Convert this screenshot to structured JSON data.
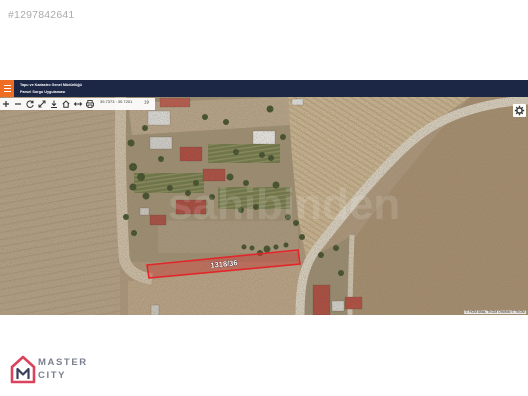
{
  "listing": {
    "id": "#1297842641"
  },
  "watermark": "sahibinden",
  "app": {
    "org_name": "Tapu ve Kadastro Genel Müdürlüğü",
    "app_name": "Parsel Sorgu Uygulaması",
    "menu_icon": "hamburger-menu-icon",
    "colors": {
      "header": "#1b2745",
      "menu_button": "#ef6c23",
      "parcel": "#e3262a"
    }
  },
  "toolbar": {
    "tools": [
      "zoom-in-icon",
      "zoom-out-icon",
      "rotate-icon",
      "fullscreen-icon",
      "download-icon",
      "home-icon",
      "measure-icon",
      "print-icon"
    ],
    "coordinates": "39.7373 : 30.7201",
    "zoom_level": "19"
  },
  "map": {
    "settings_icon": "gear-icon",
    "parcel_label": "1318/36",
    "attribution": "© HGM Atlas, TKGM Ortofoto © TKGM"
  },
  "logo": {
    "line1": "MASTER",
    "line2": "CITY",
    "colors": {
      "mark": "#d9435b",
      "mark_inner": "#3a3f5c",
      "text": "#7b7f8e"
    }
  }
}
